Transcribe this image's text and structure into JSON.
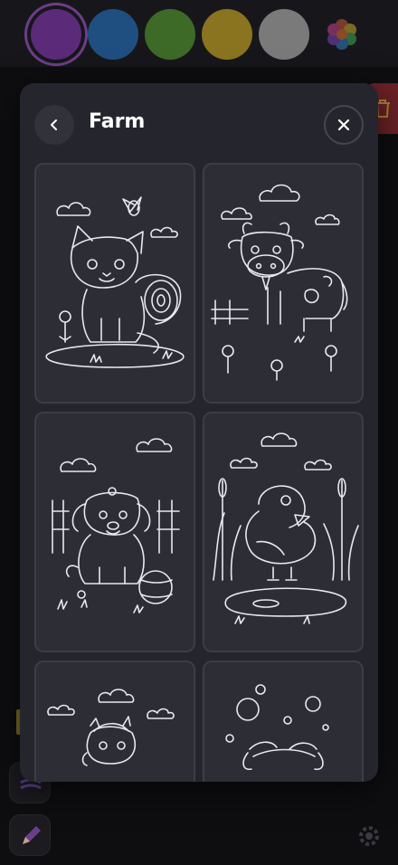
{
  "palette": {
    "colors": [
      "#5b2b7a",
      "#1f4f80",
      "#3d6a26",
      "#8a7420",
      "#7a7a7a"
    ],
    "selected_index": 0
  },
  "dialog": {
    "title": "Farm",
    "back_icon": "chevron-left-icon",
    "close_icon": "close-icon"
  },
  "pages": [
    {
      "subject": "kitten"
    },
    {
      "subject": "cow"
    },
    {
      "subject": "puppy"
    },
    {
      "subject": "duck"
    },
    {
      "subject": "horse"
    },
    {
      "subject": "pig"
    }
  ],
  "tools": [
    {
      "icon": "layers-icon"
    },
    {
      "icon": "pencil-icon"
    },
    {
      "icon": "gear-icon"
    }
  ]
}
